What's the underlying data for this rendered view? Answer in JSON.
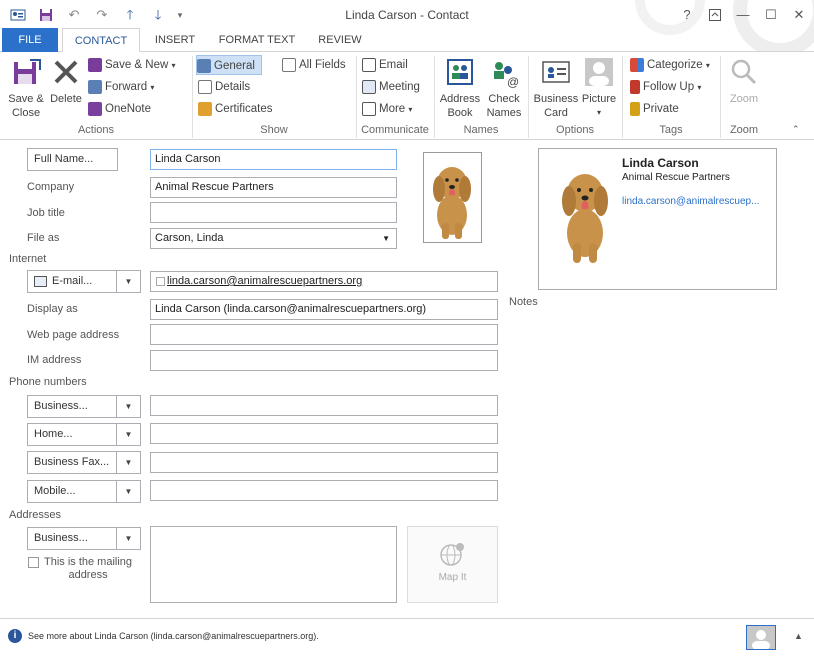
{
  "window": {
    "title": "Linda Carson - Contact",
    "help": "?",
    "restore_ribbon": "⇧",
    "minimize": "—",
    "maximize": "☐",
    "close": "✕"
  },
  "qat": {
    "save_icon": "floppy-icon",
    "undo_icon": "undo-icon",
    "redo_icon": "redo-icon",
    "up_icon": "up-arrow-icon",
    "down_icon": "down-arrow-icon",
    "more_icon": "customize-qat-icon"
  },
  "tabs": [
    "FILE",
    "CONTACT",
    "INSERT",
    "FORMAT TEXT",
    "REVIEW"
  ],
  "ribbon": {
    "actions": {
      "save_close": [
        "Save &",
        "Close"
      ],
      "delete": "Delete",
      "save_new": "Save & New",
      "forward": "Forward",
      "onenote": "OneNote",
      "label": "Actions"
    },
    "show": {
      "general": "General",
      "details": "Details",
      "certificates": "Certificates",
      "all_fields": "All Fields",
      "label": "Show"
    },
    "communicate": {
      "email": "Email",
      "meeting": "Meeting",
      "more": "More",
      "label": "Communicate"
    },
    "names": {
      "address_book": [
        "Address",
        "Book"
      ],
      "check_names": [
        "Check",
        "Names"
      ],
      "label": "Names"
    },
    "options": {
      "business_card": [
        "Business",
        "Card"
      ],
      "picture": "Picture",
      "label": "Options"
    },
    "tags": {
      "categorize": "Categorize",
      "follow_up": "Follow Up",
      "private": "Private",
      "label": "Tags"
    },
    "zoom": {
      "zoom": "Zoom",
      "label": "Zoom"
    }
  },
  "form": {
    "full_name_btn": "Full Name...",
    "full_name": "Linda Carson",
    "company_label": "Company",
    "company": "Animal Rescue Partners",
    "job_title_label": "Job title",
    "job_title": "",
    "file_as_label": "File as",
    "file_as": "Carson, Linda",
    "internet_label": "Internet",
    "email_btn": "E-mail...",
    "email": "linda.carson@animalrescuepartners.org",
    "display_as_label": "Display as",
    "display_as": "Linda Carson (linda.carson@animalrescuepartners.org)",
    "web_label": "Web page address",
    "web": "",
    "im_label": "IM address",
    "im": "",
    "phone_label": "Phone numbers",
    "phones": [
      "Business...",
      "Home...",
      "Business Fax...",
      "Mobile..."
    ],
    "addresses_label": "Addresses",
    "address_btn": "Business...",
    "mailing_label": [
      "This is the mailing",
      "address"
    ],
    "map_it": "Map It",
    "notes_label": "Notes"
  },
  "card": {
    "name": "Linda Carson",
    "company": "Animal Rescue Partners",
    "email": "linda.carson@animalrescuep..."
  },
  "status": {
    "text": "See more about Linda Carson (linda.carson@animalrescuepartners.org)."
  }
}
